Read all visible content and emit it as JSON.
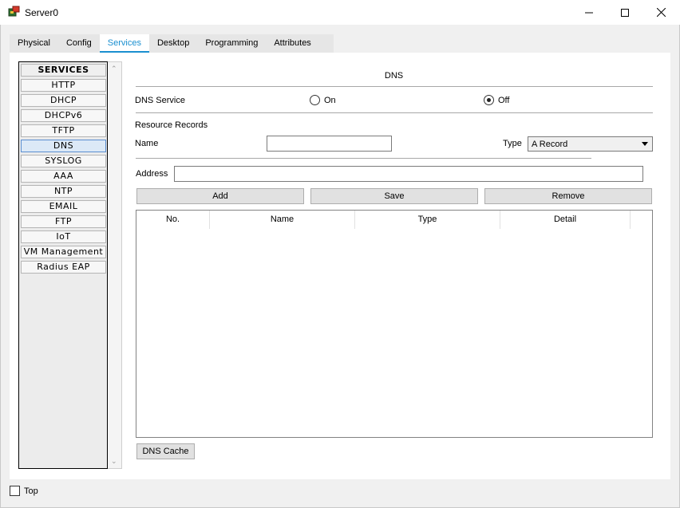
{
  "window": {
    "title": "Server0"
  },
  "tabs": [
    {
      "label": "Physical"
    },
    {
      "label": "Config"
    },
    {
      "label": "Services"
    },
    {
      "label": "Desktop"
    },
    {
      "label": "Programming"
    },
    {
      "label": "Attributes"
    }
  ],
  "active_tab": "Services",
  "services": {
    "header": "SERVICES",
    "items": [
      {
        "label": "HTTP"
      },
      {
        "label": "DHCP"
      },
      {
        "label": "DHCPv6"
      },
      {
        "label": "TFTP"
      },
      {
        "label": "DNS"
      },
      {
        "label": "SYSLOG"
      },
      {
        "label": "AAA"
      },
      {
        "label": "NTP"
      },
      {
        "label": "EMAIL"
      },
      {
        "label": "FTP"
      },
      {
        "label": "IoT"
      },
      {
        "label": "VM Management"
      },
      {
        "label": "Radius EAP"
      }
    ],
    "selected": "DNS"
  },
  "dns": {
    "title": "DNS",
    "service_label": "DNS Service",
    "on_label": "On",
    "off_label": "Off",
    "service_state": "Off",
    "resource_records_label": "Resource Records",
    "name_label": "Name",
    "name_value": "",
    "type_label": "Type",
    "type_value": "A Record",
    "address_label": "Address",
    "address_value": "",
    "add_button": "Add",
    "save_button": "Save",
    "remove_button": "Remove",
    "columns": [
      "No.",
      "Name",
      "Type",
      "Detail"
    ],
    "rows": [],
    "cache_button": "DNS Cache"
  },
  "footer": {
    "top_label": "Top",
    "top_checked": false
  },
  "colors": {
    "accent": "#1a8fd0",
    "selected_service_bg": "#dce9f7"
  }
}
